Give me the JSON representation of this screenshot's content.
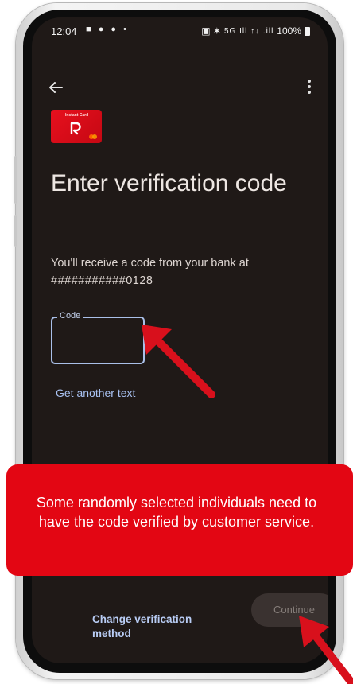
{
  "status_bar": {
    "time": "12:04",
    "left_icons": "■ ● ● •",
    "right_icons": "▣ ✶",
    "signal": "5G Ill ↑↓ .ill",
    "battery": "100%"
  },
  "icons": {
    "back": "back-arrow-icon",
    "menu": "more-vert-icon",
    "card": "card-image",
    "arrow": "red-arrow-icon"
  },
  "card": {
    "brand": "Instant Card"
  },
  "page": {
    "title": "Enter verification code",
    "subtitle": "You'll receive a code from your bank at",
    "masked_number": "###########0128"
  },
  "code_input": {
    "label": "Code",
    "value": ""
  },
  "links": {
    "get_another_text": "Get another text",
    "change_method": "Change verification method"
  },
  "buttons": {
    "continue": "Continue"
  },
  "notice": {
    "text": "Some randomly selected individuals need to have the code verified by customer service."
  },
  "colors": {
    "screen_bg": "#1f1917",
    "accent_link": "#a9c2f2",
    "banner_red": "#e30613",
    "arrow_red": "#d8101c"
  }
}
